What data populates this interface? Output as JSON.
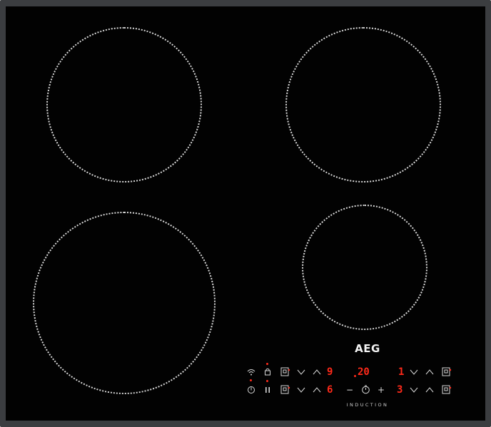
{
  "hob": {
    "brand": "AEG",
    "technology_label": "INDUCTION",
    "accent_color": "#ff2a1a",
    "zones": [
      {
        "name": "rear-left"
      },
      {
        "name": "rear-right"
      },
      {
        "name": "front-left"
      },
      {
        "name": "front-right"
      }
    ],
    "controls": {
      "row1": {
        "left_level": "9",
        "timer": "20",
        "right_level": "1"
      },
      "row2": {
        "left_level": "6",
        "minus": "−",
        "plus": "+",
        "right_level": "3"
      }
    },
    "icons": [
      "wifi-icon",
      "lock-icon",
      "power-icon",
      "pause-icon",
      "zone-select-icon",
      "chevron-down-icon",
      "chevron-up-icon",
      "timer-icon"
    ]
  }
}
